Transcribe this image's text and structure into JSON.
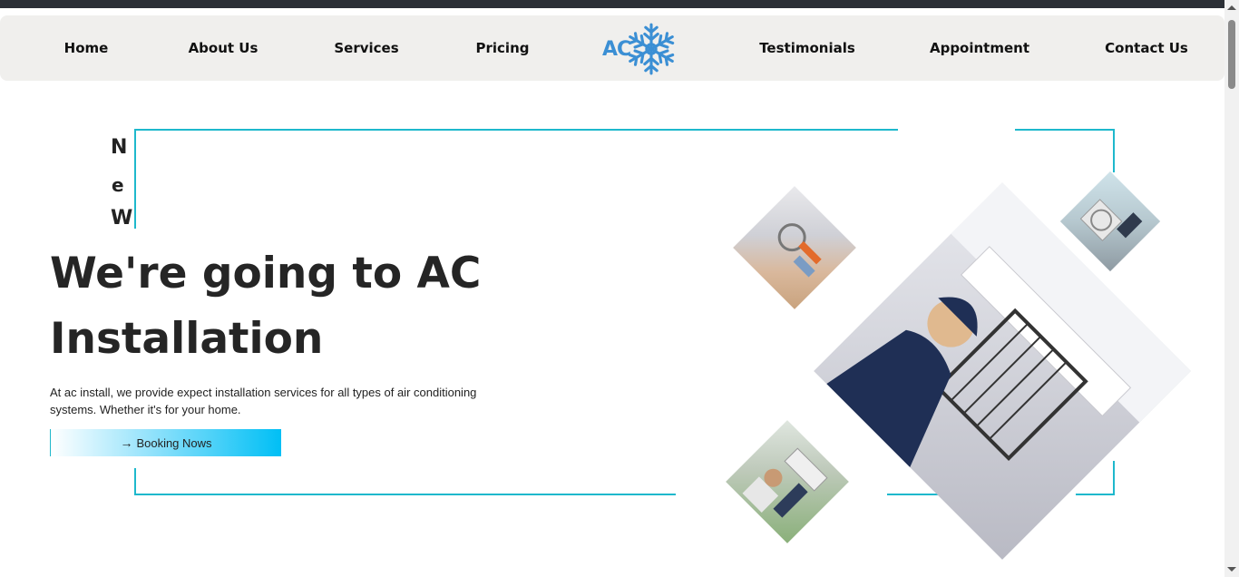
{
  "nav": {
    "home": "Home",
    "about": "About Us",
    "services": "Services",
    "pricing": "Pricing",
    "logo_text": "AC",
    "testimonials": "Testimonials",
    "appointment": "Appointment",
    "contact": "Contact Us"
  },
  "hero": {
    "new_letters": [
      "N",
      "e",
      "W"
    ],
    "title_line1": "We're going to AC",
    "title_line2": "Installation",
    "description": "At ac install, we provide expect installation services for all types of air conditioning systems. Whether it's for your home.",
    "button_icon": "arrow-right-icon",
    "button_label": "Booking Nows"
  },
  "colors": {
    "accent": "#1eb8cc",
    "logo_blue": "#3b8fd4",
    "button_gradient_end": "#00bff5",
    "nav_bg": "#f0efed"
  }
}
